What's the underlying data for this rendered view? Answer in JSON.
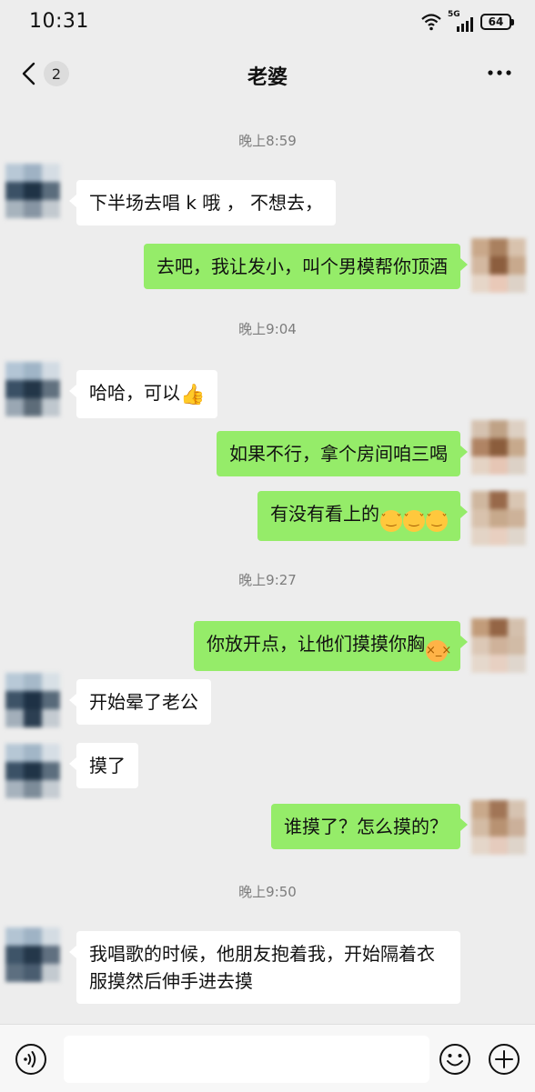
{
  "status_bar": {
    "time": "10:31",
    "network": "5G",
    "battery": "64"
  },
  "header": {
    "back_badge": "2",
    "title": "老婆"
  },
  "timestamps": [
    "晚上8:59",
    "晚上9:04",
    "晚上9:27",
    "晚上9:50"
  ],
  "messages": [
    {
      "side": "in",
      "text": "下半场去唱 k 哦 ， 不想去，"
    },
    {
      "side": "out",
      "text": "去吧，我让发小，叫个男模帮你顶酒"
    },
    {
      "side": "in",
      "text": "哈哈，可以",
      "emoji": "thumbs-up"
    },
    {
      "side": "out",
      "text": "如果不行，拿个房间咱三喝"
    },
    {
      "side": "out",
      "text": "有没有看上的",
      "emoji": "smirk x3"
    },
    {
      "side": "out",
      "text": "你放开点，让他们摸摸你胸",
      "emoji": "dizzy-face"
    },
    {
      "side": "in",
      "text": "开始晕了老公"
    },
    {
      "side": "in",
      "text": "摸了"
    },
    {
      "side": "out",
      "text": "谁摸了？怎么摸的？"
    },
    {
      "side": "in",
      "text": "我唱歌的时候，他朋友抱着我，开始隔着衣服摸然后伸手进去摸"
    }
  ],
  "input_bar": {
    "placeholder": ""
  },
  "colors": {
    "background": "#ededed",
    "incoming_bubble": "#ffffff",
    "outgoing_bubble": "#95ec69"
  }
}
